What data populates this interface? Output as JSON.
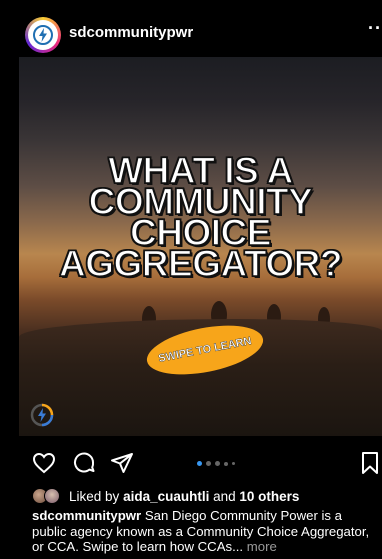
{
  "header": {
    "username": "sdcommunitypwr",
    "more_label": "··"
  },
  "post": {
    "headline_lines": [
      "WHAT IS A",
      "COMMUNITY",
      "CHOICE",
      "AGGREGATOR?"
    ],
    "swipe_label": "SWIPE TO LEARN",
    "carousel": {
      "count": 5,
      "active_index": 0
    }
  },
  "likes": {
    "prefix": "Liked by",
    "user": "aida_cuauhtli",
    "joiner": "and",
    "others": "10 others"
  },
  "caption": {
    "username": "sdcommunitypwr",
    "text": "San Diego Community Power is a public agency known as a Community Choice Aggregator, or CCA. Swipe to learn how CCAs...",
    "more_label": "more"
  },
  "icons": {
    "like": "heart-icon",
    "comment": "comment-icon",
    "share": "send-icon",
    "save": "bookmark-icon",
    "brand": "lightning-bolt-icon"
  },
  "colors": {
    "background": "#000000",
    "swipe_pill": "#f7a51a",
    "carousel_active": "#3897f0"
  }
}
